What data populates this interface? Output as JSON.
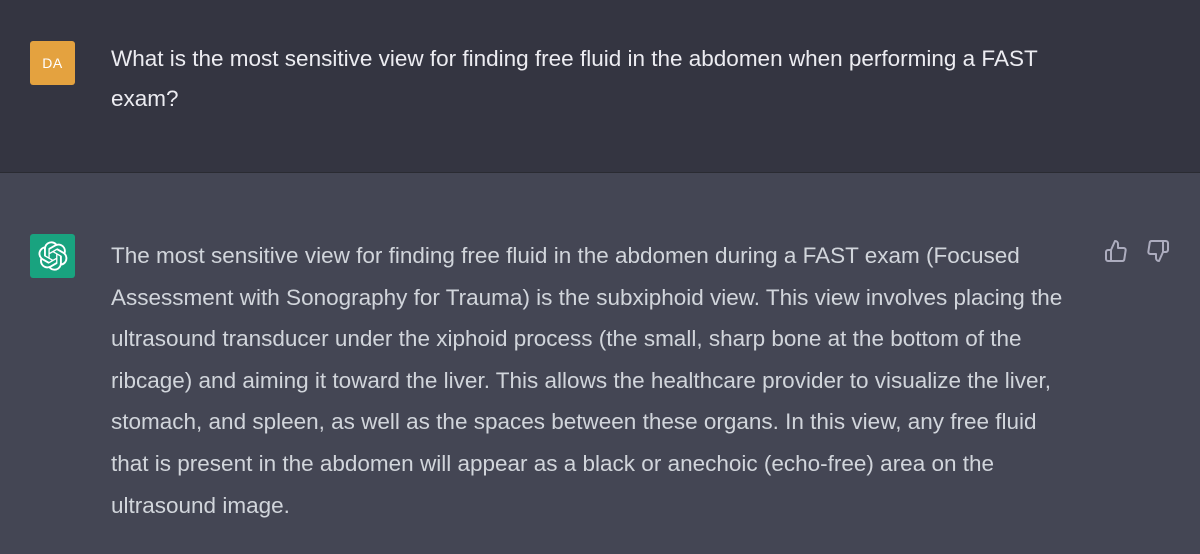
{
  "user_message": {
    "avatar_initials": "DA",
    "avatar_color": "#e4a23f",
    "text": "What is the most sensitive view for finding free fluid in the abdomen when performing a FAST exam?"
  },
  "assistant_message": {
    "avatar_icon": "openai-logo-icon",
    "avatar_color": "#19a37f",
    "text": "The most sensitive view for finding free fluid in the abdomen during a FAST exam (Focused Assessment with Sonography for Trauma) is the subxiphoid view. This view involves placing the ultrasound transducer under the xiphoid process (the small, sharp bone at the bottom of the ribcage) and aiming it toward the liver. This allows the healthcare provider to visualize the liver, stomach, and spleen, as well as the spaces between these organs. In this view, any free fluid that is present in the abdomen will appear as a black or anechoic (echo-free) area on the ultrasound image.",
    "feedback": {
      "thumbs_up_icon": "thumbs-up-icon",
      "thumbs_down_icon": "thumbs-down-icon"
    }
  },
  "colors": {
    "user_bg": "#343541",
    "assistant_bg": "#444654",
    "user_text": "#ececf1",
    "assistant_text": "#d1d5db"
  }
}
